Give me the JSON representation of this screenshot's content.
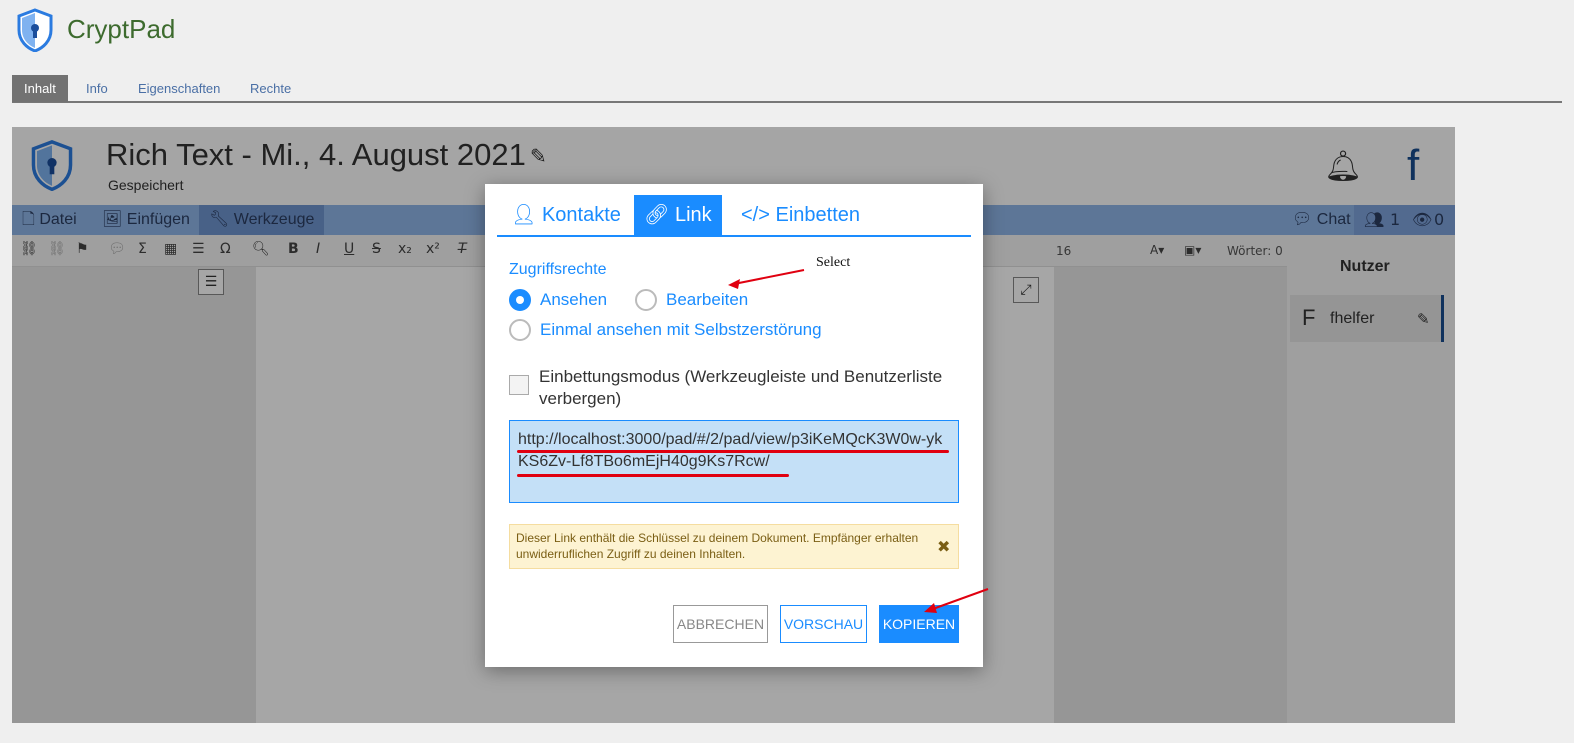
{
  "app": {
    "name": "CryptPad"
  },
  "top_tabs": [
    {
      "label": "Inhalt",
      "active": true
    },
    {
      "label": "Info",
      "active": false
    },
    {
      "label": "Eigenschaften",
      "active": false
    },
    {
      "label": "Rechte",
      "active": false
    }
  ],
  "pad": {
    "title": "Rich Text - Mi., 4. August 2021",
    "status": "Gespeichert",
    "user_initial": "f"
  },
  "menu": {
    "items": [
      {
        "label": "Datei",
        "icon": "file-icon"
      },
      {
        "label": "Einfügen",
        "icon": "image-icon"
      },
      {
        "label": "Werkzeuge",
        "icon": "wrench-icon",
        "active": true
      }
    ],
    "chat_label": "Chat",
    "users_count": "1",
    "viewers_count": "0"
  },
  "toolbar": {
    "font_size": "16",
    "words": "Wörter: 0"
  },
  "userlist": {
    "title": "Nutzer",
    "user": {
      "initial": "F",
      "name": "fhelfer"
    }
  },
  "modal": {
    "tabs": [
      {
        "label": "Kontakte",
        "icon": "contacts-icon",
        "active": false
      },
      {
        "label": "Link",
        "icon": "link-icon",
        "active": true
      },
      {
        "label": "Einbetten",
        "icon": "code-icon",
        "active": false
      }
    ],
    "access_label": "Zugriffsrechte",
    "options": {
      "view": "Ansehen",
      "edit": "Bearbeiten",
      "view_once": "Einmal ansehen mit Selbstzerstörung"
    },
    "selected_option": "view",
    "embed_label": "Einbettungsmodus (Werkzeugleiste und Benutzerliste verbergen)",
    "embed_checked": false,
    "link": "http://localhost:3000/pad/#/2/pad/view/p3iKeMQcK3W0w-ykKS6Zv-Lf8TBo6mEjH40g9Ks7Rcw/",
    "warning": "Dieser Link enthält die Schlüssel zu deinem Dokument. Empfänger erhalten unwiderruflichen Zugriff zu deinen Inhalten.",
    "buttons": {
      "cancel": "ABBRECHEN",
      "preview": "VORSCHAU",
      "copy": "KOPIEREN"
    }
  },
  "annotation": {
    "text": "Select",
    "color": "#e00010"
  },
  "colors": {
    "accent": "#1a8cff",
    "warning_bg": "#fdf3d2",
    "link_bg": "#c4e0f7"
  }
}
